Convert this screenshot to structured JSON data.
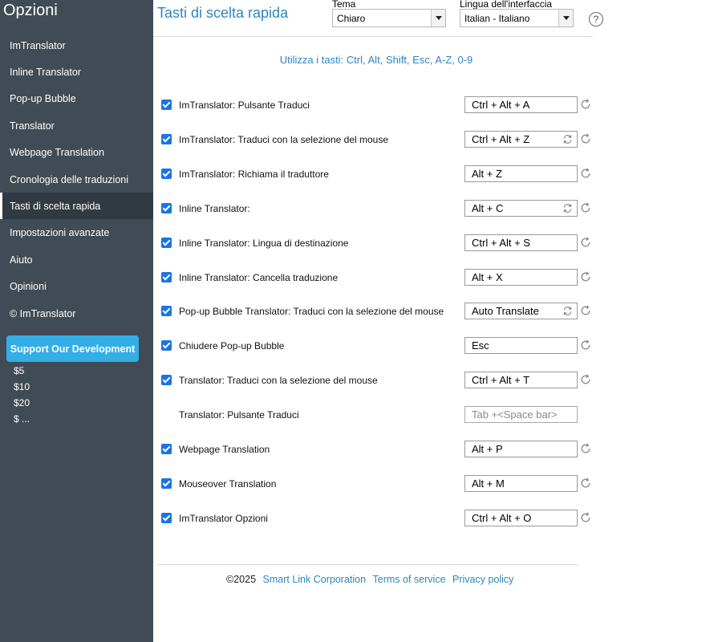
{
  "sidebar": {
    "title": "Opzioni",
    "items": [
      {
        "label": "ImTranslator"
      },
      {
        "label": "Inline Translator"
      },
      {
        "label": "Pop-up Bubble"
      },
      {
        "label": "Translator"
      },
      {
        "label": "Webpage Translation"
      },
      {
        "label": "Cronologia delle traduzioni"
      },
      {
        "label": "Tasti di scelta rapida",
        "active": true
      },
      {
        "label": "Impostazioni avanzate"
      },
      {
        "label": "Aiuto"
      },
      {
        "label": "Opinioni"
      },
      {
        "label": "© ImTranslator"
      }
    ],
    "support_label": "Support Our Development",
    "donations": [
      "$5",
      "$10",
      "$20",
      "$ ..."
    ]
  },
  "header": {
    "title": "Tasti di scelta rapida",
    "theme_label": "Tema",
    "theme_value": "Chiaro",
    "language_label": "Lingua dell'interfaccia",
    "language_value": "Italian - Italiano",
    "help_symbol": "?"
  },
  "subtitle": "Utilizza i tasti: Ctrl, Alt, Shift, Esc, A-Z, 0-9",
  "colors": {
    "sidebar_bg": "#414b55",
    "sidebar_active_bg": "#313a43",
    "accent": "#2b87c0",
    "support_button": "#33aee6",
    "checkbox": "#1a73e8"
  },
  "shortcuts": [
    {
      "label": "ImTranslator: Pulsante Traduci",
      "value": "Ctrl + Alt + A",
      "checked": true,
      "swap": false,
      "reset": true
    },
    {
      "label": "ImTranslator: Traduci con la selezione del mouse",
      "value": "Ctrl + Alt + Z",
      "checked": true,
      "swap": true,
      "reset": true
    },
    {
      "label": "ImTranslator: Richiama il traduttore",
      "value": "Alt + Z",
      "checked": true,
      "swap": false,
      "reset": true
    },
    {
      "label": "Inline Translator:",
      "value": "Alt + C",
      "checked": true,
      "swap": true,
      "reset": true
    },
    {
      "label": "Inline Translator: Lingua di destinazione",
      "value": "Ctrl + Alt + S",
      "checked": true,
      "swap": false,
      "reset": true
    },
    {
      "label": "Inline Translator: Cancella traduzione",
      "value": "Alt + X",
      "checked": true,
      "swap": false,
      "reset": true
    },
    {
      "label": "Pop-up Bubble Translator: Traduci con la selezione del mouse",
      "value": "Auto Translate",
      "checked": true,
      "swap": true,
      "reset": true
    },
    {
      "label": "Chiudere Pop-up Bubble",
      "value": "Esc",
      "checked": true,
      "swap": false,
      "reset": true
    },
    {
      "label": "Translator: Traduci con la selezione del mouse",
      "value": "Ctrl + Alt + T",
      "checked": true,
      "swap": false,
      "reset": true
    },
    {
      "label": "Translator: Pulsante Traduci",
      "value": "",
      "placeholder": "Tab +<Space bar>",
      "checked": false,
      "swap": false,
      "reset": false
    },
    {
      "label": "Webpage Translation",
      "value": "Alt + P",
      "checked": true,
      "swap": false,
      "reset": true
    },
    {
      "label": "Mouseover Translation",
      "value": "Alt + M",
      "checked": true,
      "swap": false,
      "reset": true
    },
    {
      "label": "ImTranslator Opzioni",
      "value": "Ctrl + Alt + O",
      "checked": true,
      "swap": false,
      "reset": true
    }
  ],
  "footer": {
    "copyright": "©2025",
    "company": "Smart Link Corporation",
    "terms": "Terms of service",
    "privacy": "Privacy policy"
  }
}
